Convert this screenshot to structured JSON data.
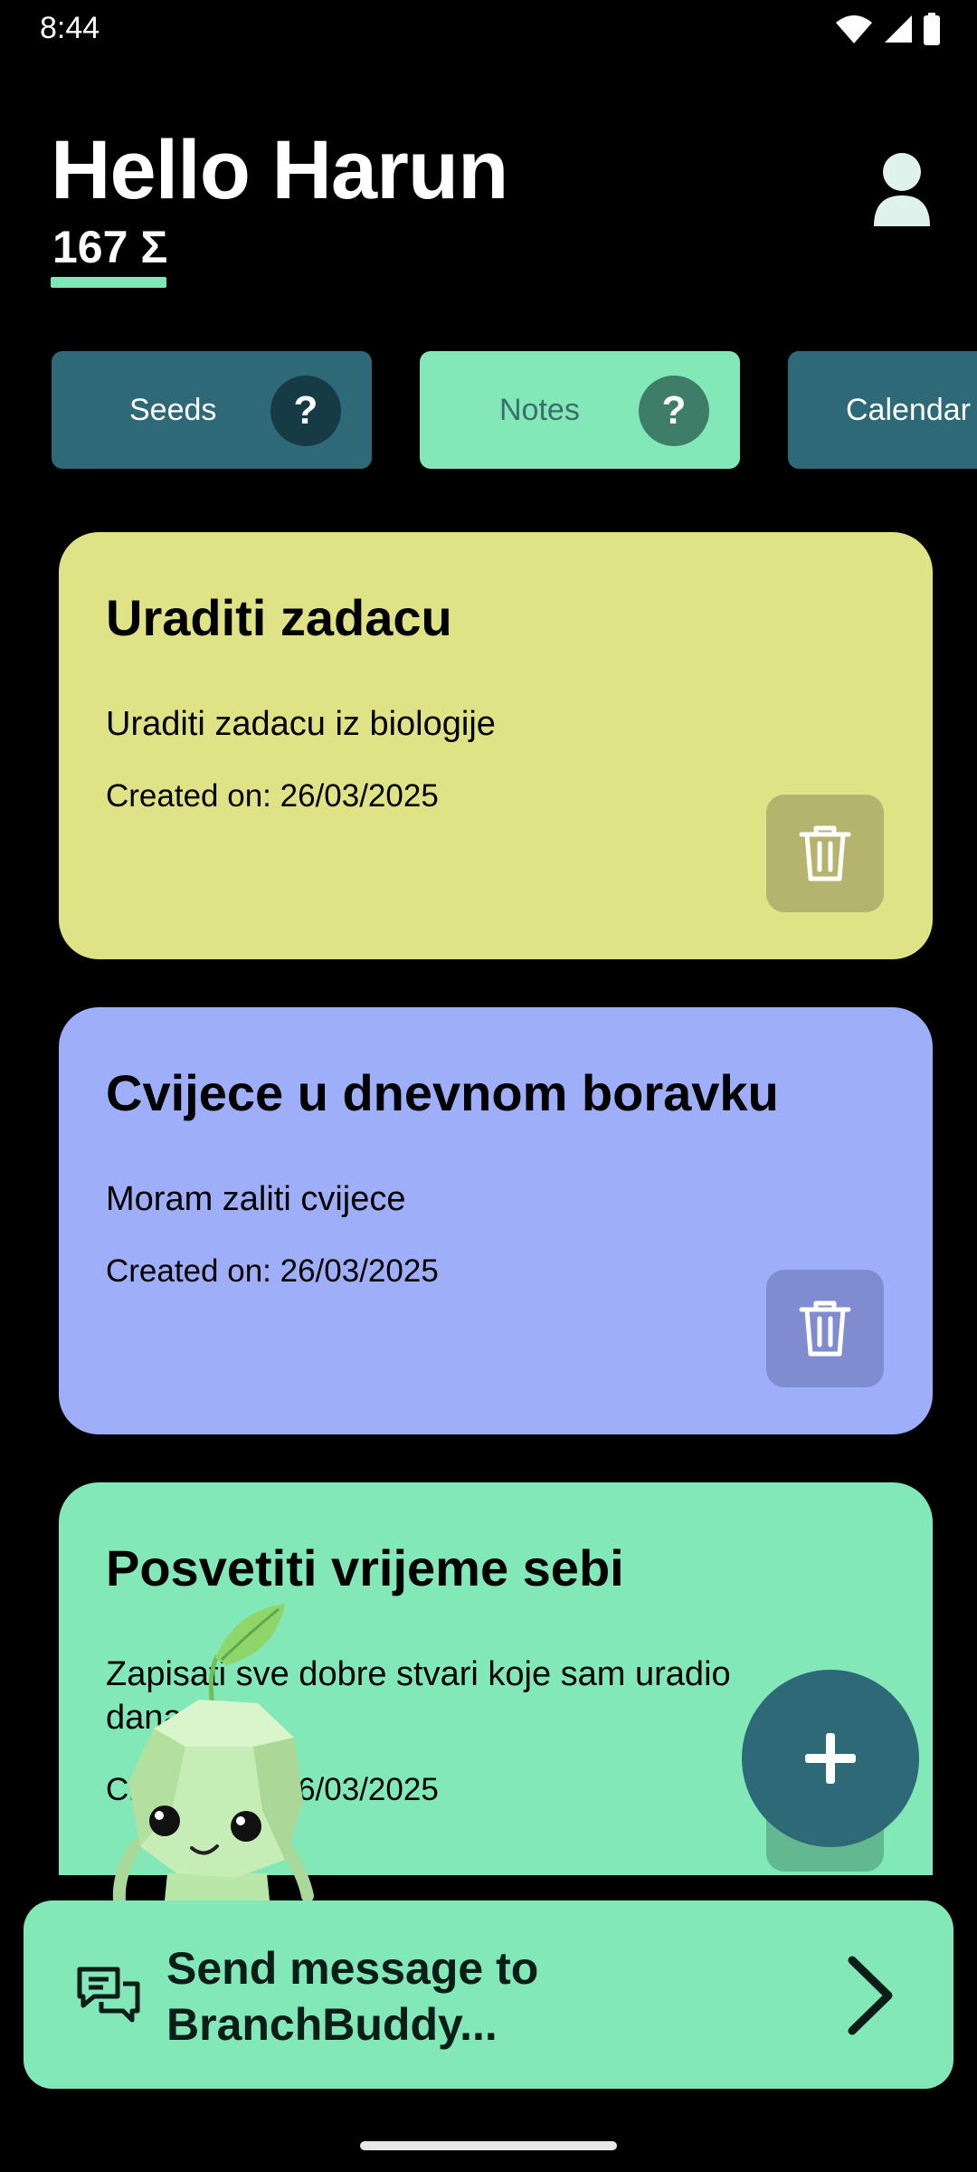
{
  "status_bar": {
    "time": "8:44"
  },
  "header": {
    "greeting": "Hello Harun",
    "points": "167 Σ"
  },
  "tabs": [
    {
      "label": "Seeds"
    },
    {
      "label": "Notes"
    },
    {
      "label": "Calendar"
    }
  ],
  "help_symbol": "?",
  "notes": [
    {
      "title": "Uraditi zadacu",
      "body": "Uraditi zadacu iz biologije",
      "date": "Created on: 26/03/2025",
      "color": "#dfe386"
    },
    {
      "title": "Cvijece u dnevnom boravku",
      "body": "Moram zaliti cvijece",
      "date": "Created on: 26/03/2025",
      "color": "#9eaef8"
    },
    {
      "title": "Posvetiti vrijeme sebi",
      "body": "Zapisati sve dobre stvari koje sam uradio danas",
      "date": "Created on: 26/03/2025",
      "color": "#82e8b7"
    }
  ],
  "chat": {
    "prompt": "Send message to BranchBuddy..."
  },
  "colors": {
    "accent": "#82e8b7",
    "primary": "#2e6978"
  }
}
